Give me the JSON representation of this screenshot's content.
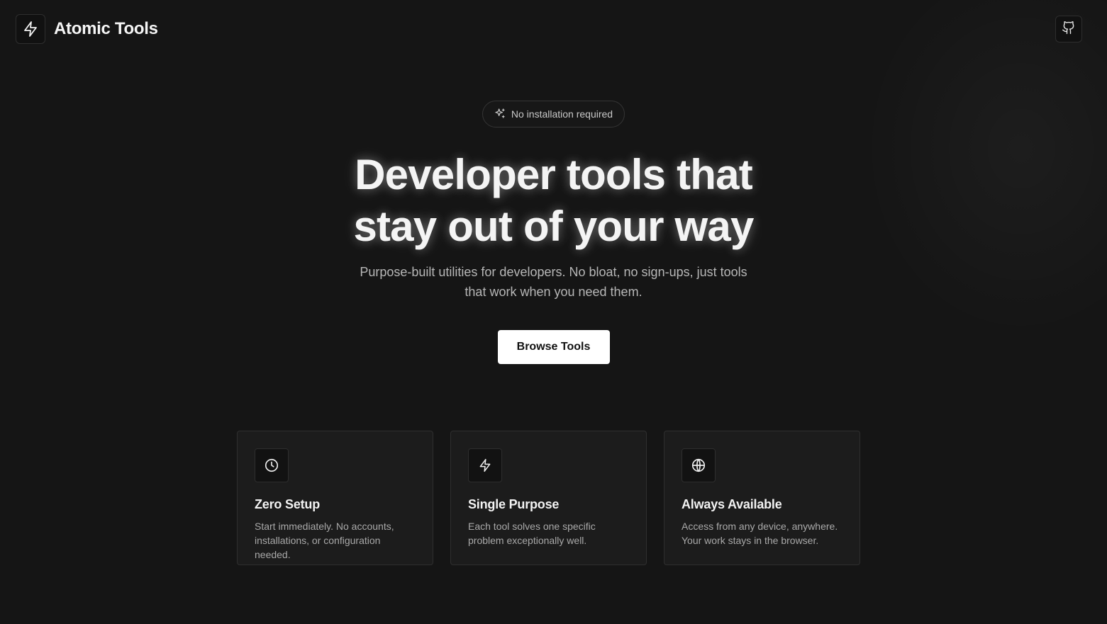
{
  "header": {
    "brand_icon": "lightning-icon",
    "brand_name": "Atomic Tools",
    "github_icon": "github-icon"
  },
  "hero": {
    "badge_icon": "sparkles-icon",
    "badge_text": "No installation required",
    "headline_line1": "Developer tools that",
    "headline_line2": "stay out of your way",
    "subtitle": "Purpose-built utilities for developers. No bloat, no sign-ups, just tools that work when you need them.",
    "cta_label": "Browse Tools"
  },
  "features": [
    {
      "icon": "clock-icon",
      "title": "Zero Setup",
      "description": "Start immediately. No accounts, installations, or configuration needed."
    },
    {
      "icon": "lightning-icon",
      "title": "Single Purpose",
      "description": "Each tool solves one specific problem exceptionally well."
    },
    {
      "icon": "globe-icon",
      "title": "Always Available",
      "description": "Access from any device, anywhere. Your work stays in the browser."
    }
  ],
  "colors": {
    "background": "#151515",
    "card_background": "#1c1c1c",
    "border": "#2f2f2f",
    "text_primary": "#f4f4f4",
    "text_secondary": "#b7b7b7",
    "cta_background": "#ffffff",
    "cta_text": "#111111"
  }
}
